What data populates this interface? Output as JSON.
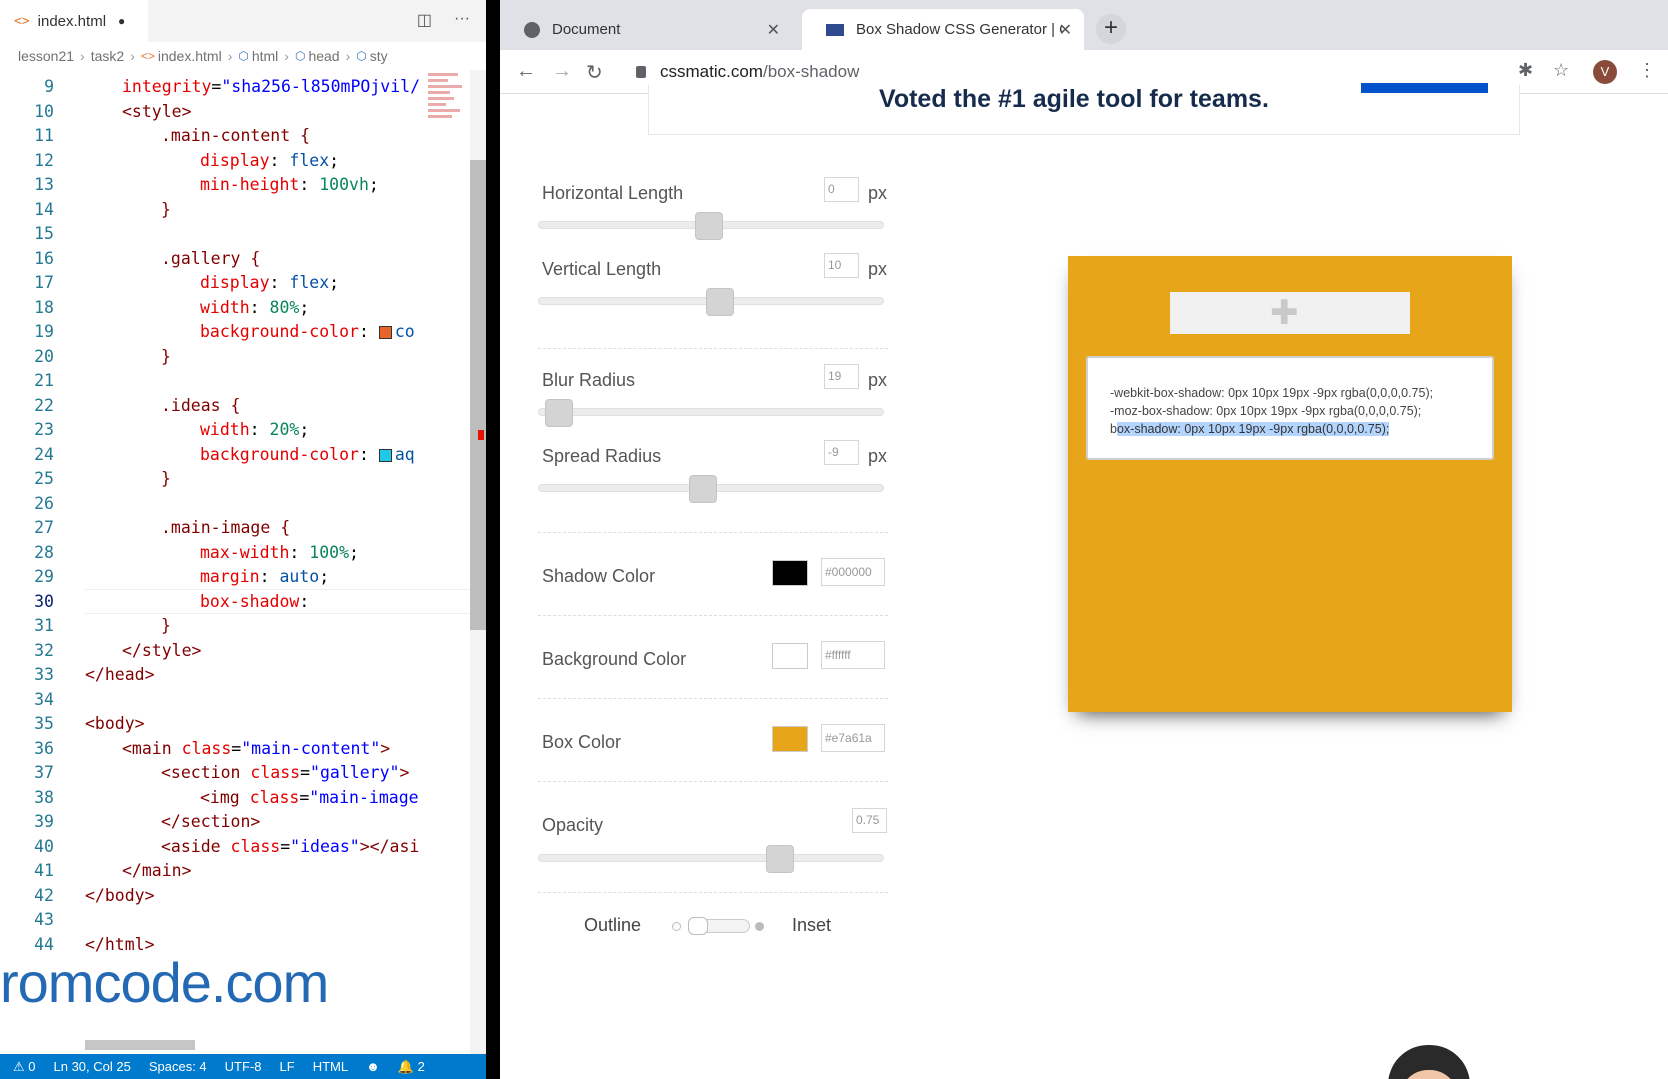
{
  "editor": {
    "tab_label": "index.html",
    "tab_dirty": "●",
    "split_icon": "split-editor-icon",
    "more_icon": "more-actions-icon",
    "breadcrumb": [
      "lesson21",
      "task2",
      "index.html",
      "html",
      "head",
      "sty"
    ],
    "lines": [
      {
        "n": "9"
      },
      {
        "n": "10"
      },
      {
        "n": "11"
      },
      {
        "n": "12"
      },
      {
        "n": "13"
      },
      {
        "n": "14"
      },
      {
        "n": "15"
      },
      {
        "n": "16"
      },
      {
        "n": "17"
      },
      {
        "n": "18"
      },
      {
        "n": "19"
      },
      {
        "n": "20"
      },
      {
        "n": "21"
      },
      {
        "n": "22"
      },
      {
        "n": "23"
      },
      {
        "n": "24"
      },
      {
        "n": "25"
      },
      {
        "n": "26"
      },
      {
        "n": "27"
      },
      {
        "n": "28"
      },
      {
        "n": "29"
      },
      {
        "n": "30"
      },
      {
        "n": "31"
      },
      {
        "n": "32"
      },
      {
        "n": "33"
      },
      {
        "n": "34"
      },
      {
        "n": "35"
      },
      {
        "n": "36"
      },
      {
        "n": "37"
      },
      {
        "n": "38"
      },
      {
        "n": "39"
      },
      {
        "n": "40"
      },
      {
        "n": "41"
      },
      {
        "n": "42"
      },
      {
        "n": "43"
      },
      {
        "n": "44"
      }
    ],
    "code": {
      "l9_attr": "integrity",
      "l9_eq": "=",
      "l9_str": "\"sha256-l850mPOjvil/",
      "l10": "<style>",
      "l11": ".main-content {",
      "l12_prop": "display",
      "l12_val": "flex",
      "l13_prop": "min-height",
      "l13_val": "100vh",
      "close": "}",
      "l16": ".gallery {",
      "l17_prop": "display",
      "l17_val": "flex",
      "l18_prop": "width",
      "l18_val": "80%",
      "l19_prop": "background-color",
      "l19_val": "co",
      "l22": ".ideas {",
      "l23_prop": "width",
      "l23_val": "20%",
      "l24_prop": "background-color",
      "l24_val": "aq",
      "l27": ".main-image {",
      "l28_prop": "max-width",
      "l28_val": "100%",
      "l29_prop": "margin",
      "l29_val": "auto",
      "l30_prop": "box-shadow",
      "l32": "</style>",
      "l33": "</head>",
      "l35": "<body>",
      "l36_tag": "<main",
      "l36_attr": "class",
      "l36_str": "\"main-content\"",
      "l36_end": ">",
      "l37_tag": "<section",
      "l37_attr": "class",
      "l37_str": "\"gallery\"",
      "l37_end": ">",
      "l38_tag": "<img",
      "l38_attr": "class",
      "l38_str": "\"main-image",
      "l39": "</section>",
      "l40_tag": "<aside",
      "l40_attr": "class",
      "l40_str": "\"ideas\"",
      "l40_end": "></asi",
      "l41": "</main>",
      "l42": "</body>",
      "l44": "</html>"
    },
    "watermark": "romcode.com",
    "swatch_colors": {
      "coral": "#e8642a",
      "aqua": "#1ec8e6"
    },
    "status": {
      "errors": "⚠ 0",
      "position": "Ln 30, Col 25",
      "spaces": "Spaces: 4",
      "encoding": "UTF-8",
      "eol": "LF",
      "language": "HTML",
      "feedback": "☻",
      "notifications": "🔔 2"
    }
  },
  "browser": {
    "tabs": [
      {
        "title": "Document",
        "close": "✕"
      },
      {
        "title": "Box Shadow CSS Generator | C",
        "close": "✕"
      }
    ],
    "new_tab": "+",
    "url_host": "cssmatic.com",
    "url_path": "/box-shadow",
    "avatar_letter": "V",
    "ad_text": "Voted the #1 agile tool for teams.",
    "controls": {
      "horizontal": {
        "label": "Horizontal Length",
        "value": "0",
        "unit": "px",
        "position": 0.5
      },
      "vertical": {
        "label": "Vertical Length",
        "value": "10",
        "unit": "px",
        "position": 0.53
      },
      "blur": {
        "label": "Blur Radius",
        "value": "19",
        "unit": "px",
        "position": 0.06
      },
      "spread": {
        "label": "Spread Radius",
        "value": "-9",
        "unit": "px",
        "position": 0.48
      },
      "shadow_color": {
        "label": "Shadow Color",
        "value": "#000000",
        "swatch": "#000000"
      },
      "background_color": {
        "label": "Background Color",
        "value": "#ffffff",
        "swatch": "#ffffff"
      },
      "box_color": {
        "label": "Box Color",
        "value": "#e7a61a",
        "swatch": "#e7a61a"
      },
      "opacity": {
        "label": "Opacity",
        "value": "0.75",
        "position": 0.72
      }
    },
    "outline_label": "Outline",
    "inset_label": "Inset",
    "output": {
      "line1": "-webkit-box-shadow: 0px 10px 19px -9px rgba(0,0,0,0.75);",
      "line2": "-moz-box-shadow: 0px 10px 19px -9px rgba(0,0,0,0.75);",
      "line3_prefix": "b",
      "line3_selected": "ox-shadow: 0px 10px 19px -9px rgba(0,0,0,0.75);"
    }
  }
}
